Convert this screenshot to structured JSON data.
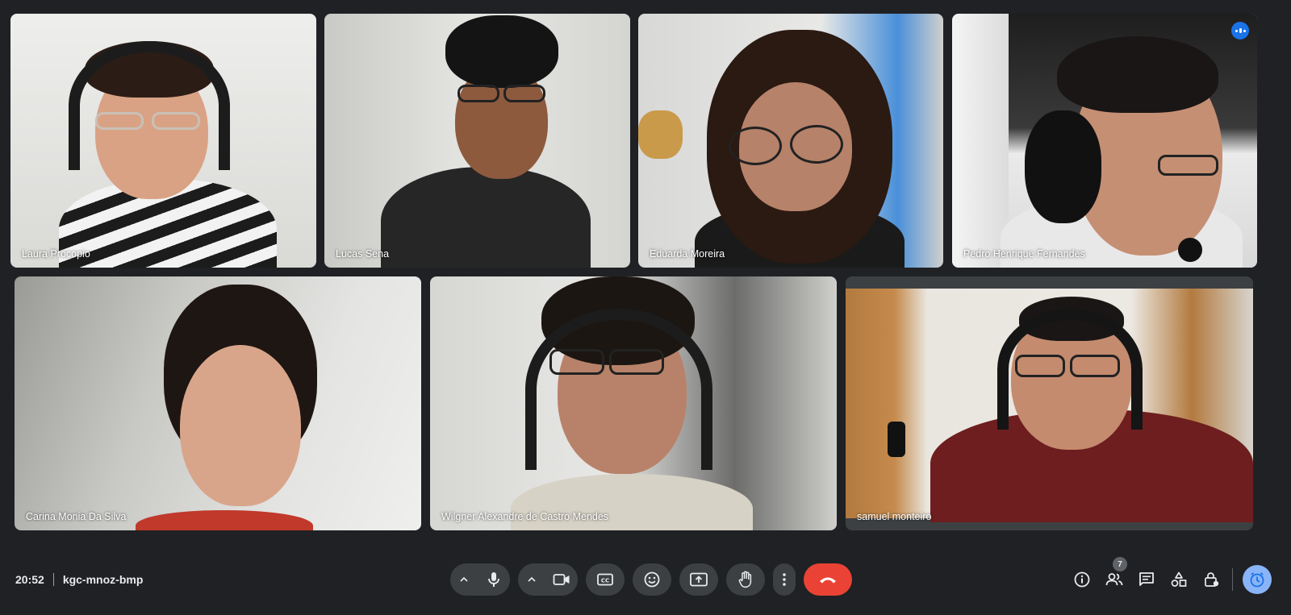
{
  "participants": [
    {
      "name": "Laura Procopio"
    },
    {
      "name": "Lucas Sena"
    },
    {
      "name": "Eduarda Moreira"
    },
    {
      "name": "Pedro Henrique Fernandes"
    },
    {
      "name": "Carina Monia Da Silva"
    },
    {
      "name": "Wilgner Alexandre de Castro Mendes"
    },
    {
      "name": "samuel monteiro"
    }
  ],
  "meeting": {
    "time": "20:52",
    "code": "kgc-mnoz-bmp"
  },
  "people": {
    "count": "7"
  },
  "colors": {
    "background": "#202124",
    "accent": "#8ab4f8",
    "hangup": "#ea4335",
    "control": "#3c4043"
  },
  "icons": [
    "chevron-up-icon",
    "microphone-icon",
    "camera-icon",
    "captions-icon",
    "emoji-icon",
    "present-icon",
    "raise-hand-icon",
    "more-options-icon",
    "hang-up-icon",
    "info-icon",
    "people-icon",
    "chat-icon",
    "activities-icon",
    "host-controls-icon",
    "timer-icon"
  ]
}
